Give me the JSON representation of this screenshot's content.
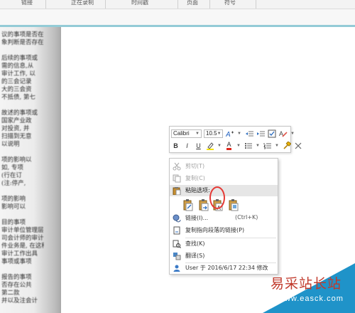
{
  "ribbon": {
    "groups": [
      "链接",
      "正在录制",
      "时间戳",
      "页面",
      "符号"
    ]
  },
  "document": {
    "lines": [
      "议的事项是否在",
      "象判断是否存在",
      "",
      "后续的事项或",
      "需的信息,从",
      "审计工作, 以",
      "的三会记录",
      "大的三会资",
      "不抵债, 第七",
      "",
      "故述的事项或",
      "国家产业政",
      "对投资, 并",
      "扫描到无意",
      "以说明",
      "",
      "项的影响以",
      "如, 专项",
      "(行在订",
      "(注:停产,",
      "",
      "项的影响",
      "影响可以",
      "",
      "目的事项",
      "审计单位管理层",
      "司会计师的审计",
      "件业务是, 在这种",
      "审计工作出具",
      "事项或事项",
      "",
      "报告的事项",
      "否存在公共",
      "第二款",
      "并以及注会计"
    ]
  },
  "mini_toolbar": {
    "font": "Calibri",
    "size": "10.5",
    "row1_icons": [
      "grow-font-icon",
      "indent-decrease-icon",
      "indent-increase-icon",
      "styles-icon",
      "clear-format-icon"
    ],
    "bold": "B",
    "italic": "I",
    "underline": "U",
    "font_color_glyph": "A"
  },
  "context_menu": {
    "cut": {
      "label": "剪切(T)"
    },
    "copy": {
      "label": "复制(C)"
    },
    "paste_options": {
      "label": "粘贴选项:"
    },
    "link": {
      "label": "链接(I)...",
      "shortcut": "(Ctrl+K)"
    },
    "copy_link": {
      "label": "复制指向段落的链接(P)"
    },
    "find": {
      "label": "查找(K)"
    },
    "translate": {
      "label": "翻译(S)"
    },
    "revision": {
      "label": "User 于 2016/6/17 22:34 修改"
    }
  },
  "watermark": {
    "text": "易采站长站",
    "url": "www.easck.com"
  },
  "colors": {
    "accent": "#93cbd6",
    "highlight_ring": "#e53935",
    "watermark_blue": "#1f93c9",
    "watermark_red": "#c0392b"
  }
}
